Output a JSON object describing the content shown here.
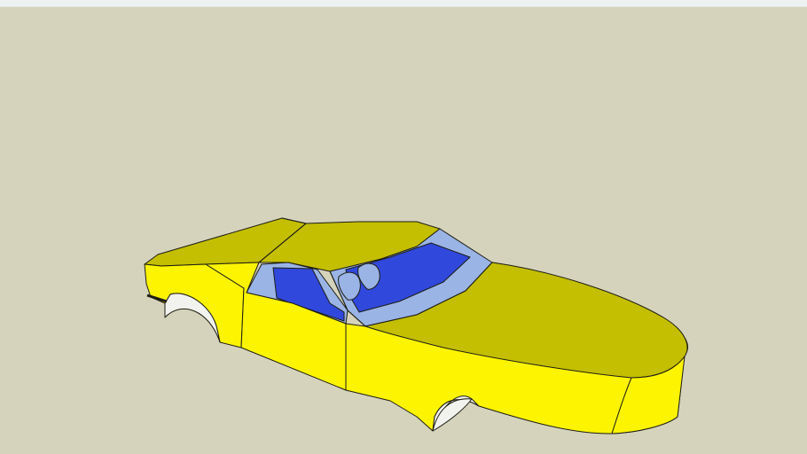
{
  "scene": {
    "colors": {
      "background": "#d6d3bc",
      "body_light": "#fcf400",
      "body_shade": "#c4bf00",
      "glass": "#9ab4e6",
      "seat": "#3048dc",
      "wheel_well": "#f2f2ef",
      "edge": "#1d1d12"
    }
  }
}
